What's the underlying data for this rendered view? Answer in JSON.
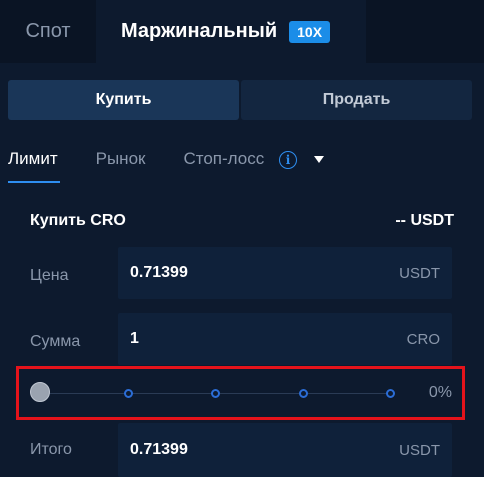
{
  "top_tabs": {
    "spot": "Спот",
    "margin": "Маржинальный",
    "leverage": "10X"
  },
  "side": {
    "buy": "Купить",
    "sell": "Продать"
  },
  "order_types": {
    "limit": "Лимит",
    "market": "Рынок",
    "stop_loss": "Стоп-лосс"
  },
  "order": {
    "title": "Купить CRO",
    "balance": "-- USDT",
    "price_label": "Цена",
    "price_value": "0.71399",
    "price_unit": "USDT",
    "amount_label": "Сумма",
    "amount_value": "1",
    "amount_unit": "CRO",
    "total_label": "Итого",
    "total_value": "0.71399",
    "total_unit": "USDT"
  },
  "slider": {
    "percent_text": "0%",
    "value_fraction": 0
  },
  "icons": {
    "info": "info-icon",
    "caret": "chevron-down-icon"
  },
  "colors": {
    "accent": "#2e8ef0",
    "badge": "#1b8de8",
    "highlight": "#e4131b"
  }
}
